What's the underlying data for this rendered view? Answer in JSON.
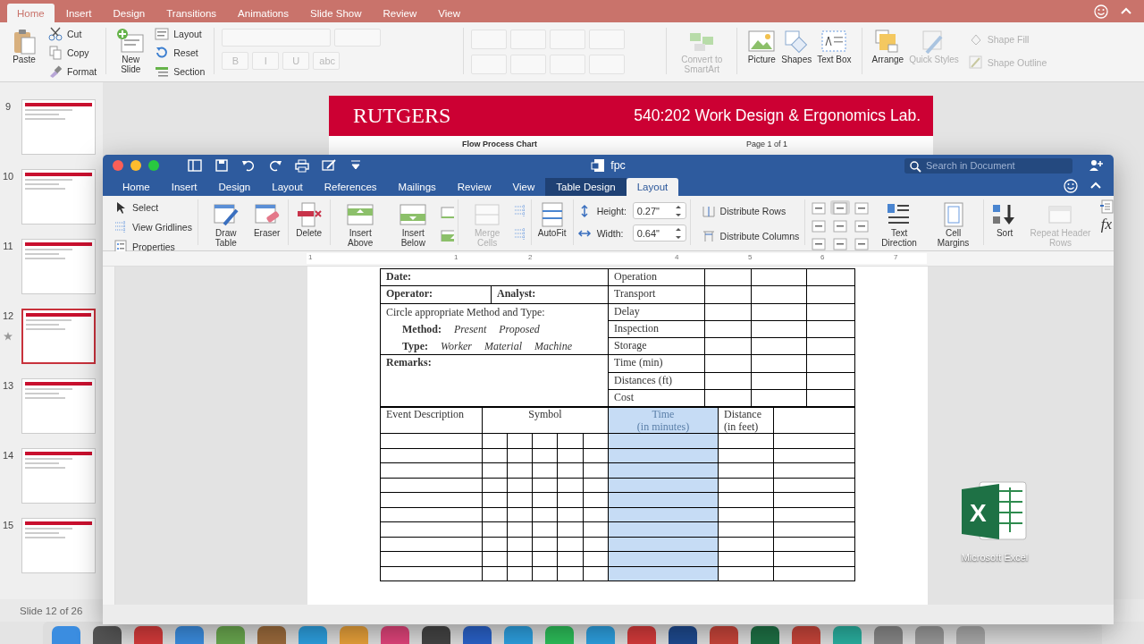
{
  "powerpoint": {
    "tabs": [
      {
        "label": "Home",
        "selected": true
      },
      {
        "label": "Insert",
        "selected": false
      },
      {
        "label": "Design",
        "selected": false
      },
      {
        "label": "Transitions",
        "selected": false
      },
      {
        "label": "Animations",
        "selected": false
      },
      {
        "label": "Slide Show",
        "selected": false
      },
      {
        "label": "Review",
        "selected": false
      },
      {
        "label": "View",
        "selected": false
      }
    ],
    "paste": "Paste",
    "clipboard": [
      "Cut",
      "Copy",
      "Format"
    ],
    "new_slide": "New Slide",
    "slide_tools": [
      "Layout",
      "Reset",
      "Section"
    ],
    "font_controls_disabled": true,
    "font_buttons": [
      "B",
      "I",
      "U",
      "abc"
    ],
    "large_buttons": [
      {
        "label": "Convert to SmartArt",
        "kind": "smartart",
        "disabled": true
      },
      {
        "label": "Picture",
        "kind": "picture",
        "disabled": false
      },
      {
        "label": "Shapes",
        "kind": "shapes",
        "disabled": false
      },
      {
        "label": "Text Box",
        "kind": "textbox",
        "disabled": false
      },
      {
        "label": "Arrange",
        "kind": "arrange",
        "disabled": false
      },
      {
        "label": "Quick Styles",
        "kind": "styles",
        "disabled": true
      }
    ],
    "shape_options": [
      {
        "label": "Shape Fill",
        "disabled": true
      },
      {
        "label": "Shape Outline",
        "disabled": true
      }
    ],
    "slides": [
      {
        "number": "9",
        "selected": false,
        "starred": false
      },
      {
        "number": "10",
        "selected": false,
        "starred": false
      },
      {
        "number": "11",
        "selected": false,
        "starred": false
      },
      {
        "number": "12",
        "selected": true,
        "starred": true
      },
      {
        "number": "13",
        "selected": false,
        "starred": false
      },
      {
        "number": "14",
        "selected": false,
        "starred": false
      },
      {
        "number": "15",
        "selected": false,
        "starred": false
      }
    ],
    "status": "Slide 12 of 26",
    "slide": {
      "logo": "RUTGERS",
      "course": "540:202 Work Design & Ergonomics Lab.",
      "chart_title": "Flow Process Chart",
      "page": "Page 1 of 1"
    }
  },
  "word": {
    "title": "fpc",
    "search": {
      "placeholder": "Search in Document"
    },
    "tabs": [
      {
        "label": "Home",
        "selected": false,
        "contextual": false
      },
      {
        "label": "Insert",
        "selected": false,
        "contextual": false
      },
      {
        "label": "Design",
        "selected": false,
        "contextual": false
      },
      {
        "label": "Layout",
        "selected": false,
        "contextual": false
      },
      {
        "label": "References",
        "selected": false,
        "contextual": false
      },
      {
        "label": "Mailings",
        "selected": false,
        "contextual": false
      },
      {
        "label": "Review",
        "selected": false,
        "contextual": false
      },
      {
        "label": "View",
        "selected": false,
        "contextual": false
      },
      {
        "label": "Table Design",
        "selected": false,
        "contextual": true
      },
      {
        "label": "Layout",
        "selected": true,
        "contextual": true
      }
    ],
    "table_group": [
      "Select",
      "View Gridlines",
      "Properties"
    ],
    "tools": [
      {
        "label": "Draw Table",
        "kind": "draw",
        "disabled": false
      },
      {
        "label": "Eraser",
        "kind": "eraser",
        "disabled": false
      },
      {
        "label": "Delete",
        "kind": "delete",
        "disabled": false
      },
      {
        "label": "Insert Above",
        "kind": "insert-above",
        "disabled": false
      },
      {
        "label": "Insert Below",
        "kind": "insert-below",
        "disabled": false
      },
      {
        "label": "Merge Cells",
        "kind": "merge",
        "disabled": true
      },
      {
        "label": "AutoFit",
        "kind": "autofit",
        "disabled": false
      }
    ],
    "height": {
      "label": "Height:",
      "value": "0.27\""
    },
    "width": {
      "label": "Width:",
      "value": "0.64\""
    },
    "distribute": [
      "Distribute Rows",
      "Distribute Columns"
    ],
    "alignment": [
      {
        "selected": false
      },
      {
        "selected": true
      },
      {
        "selected": false
      },
      {
        "selected": false
      },
      {
        "selected": false
      },
      {
        "selected": false
      },
      {
        "selected": false
      },
      {
        "selected": false
      },
      {
        "selected": false
      }
    ],
    "cell_tools": [
      {
        "label": "Text Direction",
        "kind": "text-direction",
        "disabled": false
      },
      {
        "label": "Cell Margins",
        "kind": "margins",
        "disabled": false
      },
      {
        "label": "Sort",
        "kind": "sort",
        "disabled": false
      },
      {
        "label": "Repeat Header Rows",
        "kind": "repeat",
        "disabled": true
      }
    ],
    "formula": "fx",
    "ruler": [
      "1",
      "1",
      "2",
      "4",
      "5",
      "6",
      "7"
    ],
    "form": {
      "date": "Date:",
      "operator": "Operator:",
      "analyst": "Analyst:",
      "instruction": "Circle appropriate Method and Type:",
      "method": {
        "label": "Method:",
        "options": [
          "Present",
          "Proposed"
        ]
      },
      "type": {
        "label": "Type:",
        "options": [
          "Worker",
          "Material",
          "Machine"
        ]
      },
      "remarks": "Remarks:",
      "summary": [
        "Operation",
        "Transport",
        "Delay",
        "Inspection",
        "Storage",
        "Time (min)",
        "Distances (ft)",
        "Cost"
      ],
      "event_columns": [
        {
          "lines": [
            "Event Description"
          ],
          "kind": "text",
          "selected": false
        },
        {
          "lines": [
            "Symbol"
          ],
          "kind": "symbol",
          "selected": false
        },
        {
          "lines": [
            "Time",
            "(in minutes)"
          ],
          "kind": "text",
          "selected": true
        },
        {
          "lines": [
            "Distance",
            "(in feet)"
          ],
          "kind": "text",
          "selected": false
        },
        {
          "kind": "blank",
          "selected": false
        }
      ]
    }
  },
  "desktop_icon": {
    "logo_letter": "X",
    "label": "Microsoft Excel"
  }
}
